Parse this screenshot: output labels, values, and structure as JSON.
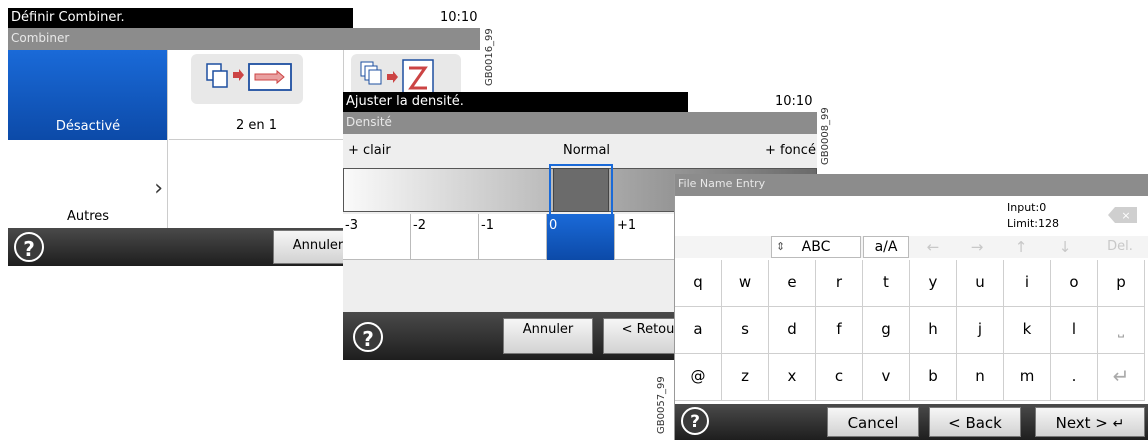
{
  "screen1": {
    "title": "Définir Combiner.",
    "time": "10:10",
    "section": "Combiner",
    "option_off": "Désactivé",
    "option_2in1": "2 en 1",
    "option_others": "Autres",
    "cancel": "Annuler",
    "ref": "GB0016_99",
    "help": "?"
  },
  "screen2": {
    "title": "Ajuster la densité.",
    "time": "10:10",
    "section": "Densité",
    "light_label": "+ clair",
    "normal_label": "Normal",
    "dark_label": "+ foncé",
    "levels": [
      "-3",
      "-2",
      "-1",
      "0",
      "+1"
    ],
    "selected_level": "0",
    "cancel": "Annuler",
    "back": "< Retou",
    "ref": "GB0008_99",
    "help": "?"
  },
  "screen3": {
    "section": "File Name Entry",
    "input_count": "Input:0",
    "limit": "Limit:128",
    "ctrl_abc": "ABC",
    "ctrl_case": "a/A",
    "del": "Del.",
    "row1": [
      "q",
      "w",
      "e",
      "r",
      "t",
      "y",
      "u",
      "i",
      "o",
      "p"
    ],
    "row2": [
      "a",
      "s",
      "d",
      "f",
      "g",
      "h",
      "j",
      "k",
      "l"
    ],
    "row3": [
      "@",
      "z",
      "x",
      "c",
      "v",
      "b",
      "n",
      "m",
      "."
    ],
    "cancel": "Cancel",
    "back": "< Back",
    "next": "Next >",
    "ref": "GB0057_99",
    "help": "?"
  },
  "colors": {
    "selected_blue": "#1460c8",
    "titlebar": "#000000",
    "subbar": "#8c8c8c"
  }
}
